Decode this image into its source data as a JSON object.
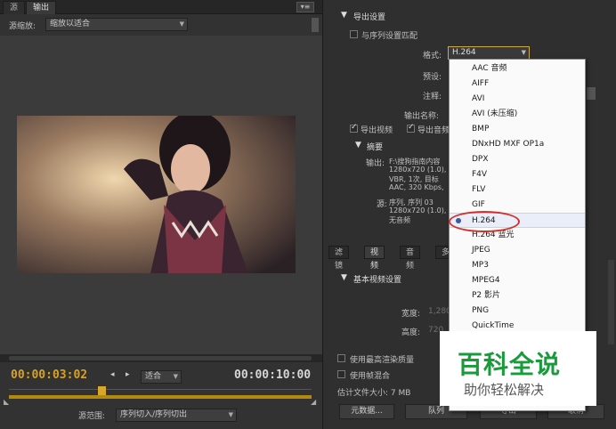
{
  "source_panel": {
    "tabs": [
      "源",
      "输出"
    ],
    "zoom_label": "源缩放:",
    "zoom_value": "缩放以适合",
    "timecode_current": "00:00:03:02",
    "fit_value": "适合",
    "timecode_duration": "00:00:10:00",
    "range_label": "源范围:",
    "range_value": "序列切入/序列切出"
  },
  "export_settings": {
    "header": "导出设置",
    "match_sequence": "与序列设置匹配",
    "format_label": "格式:",
    "format_value": "H.264",
    "preset_label": "预设:",
    "comment_label": "注释:",
    "output_name_label": "输出名称:",
    "export_video": "导出视频",
    "export_audio": "导出音频",
    "summary_header": "摘要",
    "output_label": "输出:",
    "output_lines": [
      "F:\\搜狗指南内容",
      "1280x720 (1.0),",
      "VBR, 1次, 目标",
      "AAC, 320 Kbps,"
    ],
    "source_label": "源:",
    "source_lines": [
      "序列, 序列 03",
      "1280x720 (1.0),",
      "无音频"
    ]
  },
  "settings_tabs": [
    "滤镜",
    "视频",
    "音频",
    "多"
  ],
  "video_section": {
    "header": "基本视频设置",
    "width_label": "宽度:",
    "width_value": "1,280",
    "height_label": "高度:",
    "height_value": "720"
  },
  "bottom": {
    "max_render": "使用最高渲染质量",
    "frame_blend": "使用帧混合",
    "file_size": "估计文件大小: 7 MB",
    "metadata_btn": "元数据...",
    "queue_btn": "队列",
    "export_btn": "导出",
    "cancel_btn": "取消"
  },
  "format_options": [
    "AAC 音频",
    "AIFF",
    "AVI",
    "AVI (未压缩)",
    "BMP",
    "DNxHD MXF OP1a",
    "DPX",
    "F4V",
    "FLV",
    "GIF",
    "H.264",
    "H.264 蓝光",
    "JPEG",
    "MP3",
    "MPEG4",
    "P2 影片",
    "PNG",
    "QuickTime"
  ],
  "selected_format": "H.264",
  "watermark": {
    "title": "百科全说",
    "subtitle": "助你轻松解决"
  },
  "colors": {
    "timecode": "#d9a21e",
    "accent_green": "#1a9b3b",
    "highlight_red": "#d2312b"
  }
}
